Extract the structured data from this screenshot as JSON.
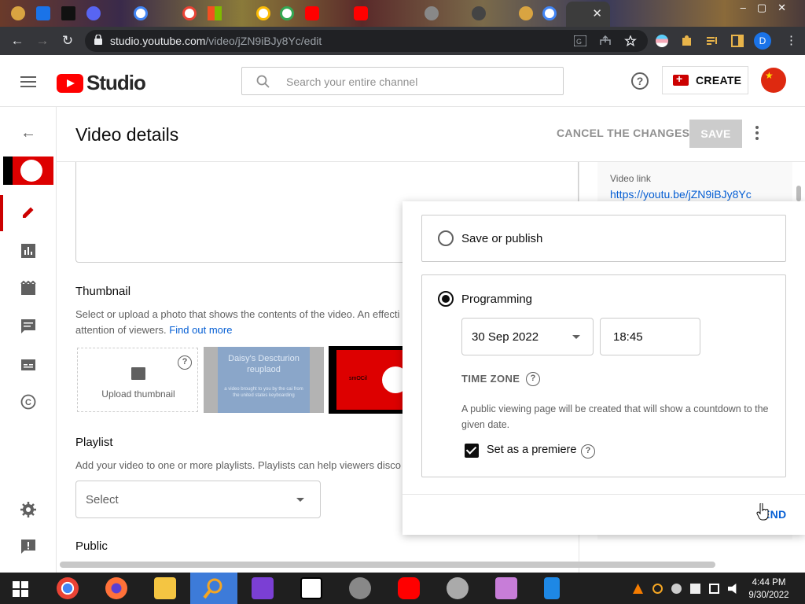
{
  "browser": {
    "url_host": "studio.youtube.com",
    "url_path": "/video/jZN9iBJy8Yc/edit",
    "profile_initial": "D",
    "active_tab_close": "✕"
  },
  "header": {
    "logo_text": "Studio",
    "search_placeholder": "Search your entire channel",
    "help_label": "?",
    "create_label": "CREATE"
  },
  "page": {
    "title": "Video details",
    "cancel_label": "CANCEL THE CHANGES",
    "save_label": "SAVE"
  },
  "thumbnail": {
    "title": "Thumbnail",
    "description": "Select or upload a photo that shows the contents of the video. An effecti",
    "description_line2": "attention of viewers.",
    "find_out_more": "Find out more",
    "upload_label": "Upload thumbnail",
    "thumb2_title": "Daisy's Descturion reuplaod",
    "thumb2_sub": "a video brought to you by the cai from the united states keyboarding",
    "thumb3_text": "smOCil"
  },
  "playlist": {
    "title": "Playlist",
    "description": "Add your video to one or more playlists. Playlists can help viewers disco",
    "select_value": "Select"
  },
  "public_section": {
    "title": "Public"
  },
  "video_link": {
    "label": "Video link",
    "url": "https://youtu.be/jZN9iBJy8Yc"
  },
  "visibility_popup": {
    "option_save_publish": "Save or publish",
    "option_programming": "Programming",
    "date": "30 Sep 2022",
    "time": "18:45",
    "timezone_label": "TIME ZONE",
    "premiere_desc": "A public viewing page will be created that will show a countdown to the given date.",
    "premiere_label": "Set as a premiere",
    "premiere_checked": true,
    "send_label": "END"
  },
  "taskbar": {
    "time": "4:44 PM",
    "date": "9/30/2022"
  },
  "colors": {
    "accent_red": "#ff0000",
    "link_blue": "#065fd4",
    "save_disabled": "#cccccc",
    "create_icon": "#cc0000"
  },
  "icons": [
    "menu-icon",
    "search-icon",
    "help-icon",
    "create-video-icon",
    "back-arrow-icon",
    "pencil-icon",
    "analytics-icon",
    "editor-icon",
    "comments-icon",
    "subtitles-icon",
    "copyright-icon",
    "settings-icon",
    "feedback-icon",
    "more-vert-icon",
    "add-photo-icon",
    "dropdown-caret-icon"
  ]
}
